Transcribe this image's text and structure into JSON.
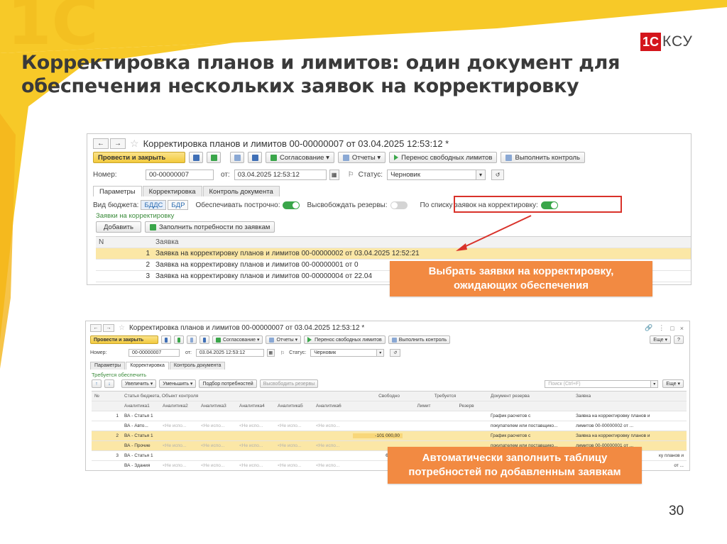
{
  "slide": {
    "title_line1": "Корректировка планов и лимитов: один документ для",
    "title_line2": "обеспечения нескольких заявок на корректировку",
    "logo_part1": "1С",
    "logo_part2": "КСУ",
    "page_number": "30",
    "accent_colors": {
      "yellow": "#f7c928",
      "orange": "#f28a42",
      "red": "#d9322a"
    }
  },
  "window1": {
    "title": "Корректировка планов и лимитов 00-00000007 от 03.04.2025 12:53:12 *",
    "nav_back": "←",
    "nav_forward": "→",
    "star": "☆",
    "toolbar": {
      "post_close": "Провести и закрыть",
      "approval": "Согласование",
      "reports": "Отчеты",
      "transfer": "Перенос свободных лимитов",
      "run_control": "Выполнить контроль"
    },
    "fields": {
      "number_label": "Номер:",
      "number_value": "00-00000007",
      "date_label": "от:",
      "date_value": "03.04.2025 12:53:12",
      "status_label": "Статус:",
      "status_value": "Черновик"
    },
    "tabs": [
      "Параметры",
      "Корректировка",
      "Контроль документа"
    ],
    "options": {
      "budget_type_label": "Вид бюджета:",
      "budget_type_a": "БДДС",
      "budget_type_b": "БДР",
      "line_by_line_label": "Обеспечивать построчно:",
      "release_reserves_label": "Высвобождать резервы:",
      "by_requests_label": "По списку заявок на корректировку:"
    },
    "section_label": "Заявки на корректировку",
    "buttons": {
      "add": "Добавить",
      "fill_needs": "Заполнить потребности по заявкам"
    },
    "table": {
      "columns": [
        "N",
        "Заявка"
      ],
      "rows": [
        {
          "n": "1",
          "request": "Заявка на корректировку планов и лимитов 00-00000002 от 03.04.2025 12:52:21"
        },
        {
          "n": "2",
          "request": "Заявка на корректировку планов и лимитов 00-00000001 от 0"
        },
        {
          "n": "3",
          "request": "Заявка на корректировку планов и лимитов 00-00000004 от 22.04"
        }
      ]
    }
  },
  "callout1": {
    "line1": "Выбрать заявки на корректировку,",
    "line2": "ожидающих обеспечения"
  },
  "window2": {
    "title": "Корректировка планов и лимитов 00-00000007 от 03.04.2025 12:53:12 *",
    "nav_back": "←",
    "nav_forward": "→",
    "star": "☆",
    "window_controls": [
      "🔗",
      "⋮",
      "□",
      "×"
    ],
    "toolbar": {
      "post_close": "Провести и закрыть",
      "approval": "Согласование",
      "reports": "Отчеты",
      "transfer": "Перенос свободных лимитов",
      "run_control": "Выполнить контроль",
      "more": "Еще"
    },
    "fields": {
      "number_label": "Номер:",
      "number_value": "00-00000007",
      "date_label": "от:",
      "date_value": "03.04.2025 12:53:12",
      "status_label": "Статус:",
      "status_value": "Черновик"
    },
    "tabs": [
      "Параметры",
      "Корректировка",
      "Контроль документа"
    ],
    "section_label": "Требуется обеспечить",
    "toolbar2": {
      "up": "↑",
      "down": "↓",
      "increase": "Увеличить",
      "decrease": "Уменьшить",
      "pick_needs": "Подбор потребностей",
      "release_reserves": "Высвободить резервы",
      "search_placeholder": "Поиск (Ctrl+F)",
      "more": "Еще"
    },
    "table": {
      "head1": [
        "№",
        "Статья бюджета, Объект контроля",
        "Свободно",
        "Требуется",
        "Документ резерва",
        "Заявка"
      ],
      "head2": [
        "Аналитика1",
        "Аналитика2",
        "Аналитика3",
        "Аналитика4",
        "Аналитика5",
        "Аналитика6",
        "Лимит",
        "Резерв"
      ],
      "placeholder": "<Не испо...",
      "rows": [
        {
          "n": "1",
          "article": "ВА - Статья 1",
          "sub": "ВА - Авто...",
          "free": "",
          "reserve_doc_1": "График расчетов с",
          "reserve_doc_2": "покупателем или поставщико...",
          "request_1": "Заявка на корректировку планов и",
          "request_2": "лимитов 00-00000002 от ..."
        },
        {
          "n": "2",
          "article": "ВА - Статья 1",
          "sub": "ВА - Прочие",
          "free": "-101 000,00",
          "reserve_doc_1": "График расчетов с",
          "reserve_doc_2": "покупателем или поставщико...",
          "request_1": "Заявка на корректировку планов и",
          "request_2": "лимитов 00-00000001 от ..."
        },
        {
          "n": "3",
          "article": "ВА - Статья 1",
          "sub": "ВА - Здания",
          "free": "600 00",
          "reserve_doc_1": "",
          "reserve_doc_2": "",
          "request_1": "ку планов и",
          "request_2": "от ..."
        }
      ]
    }
  },
  "callout2": {
    "line1": "Автоматически заполнить таблицу",
    "line2": "потребностей по добавленным заявкам"
  }
}
